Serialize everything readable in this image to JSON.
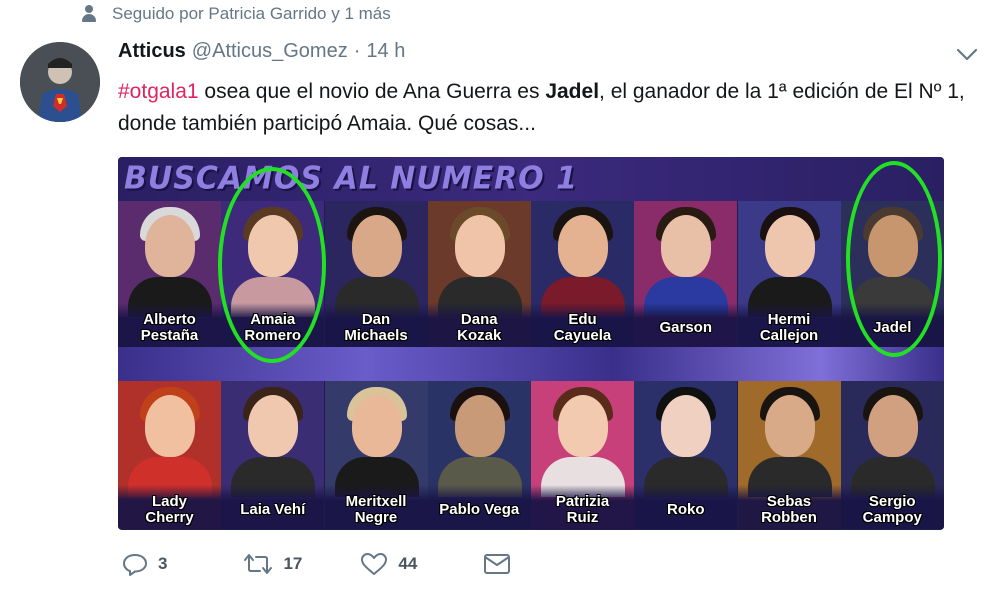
{
  "social_context": {
    "text": "Seguido por Patricia Garrido y 1 más"
  },
  "tweet": {
    "name": "Atticus",
    "handle": "@Atticus_Gomez",
    "separator": "·",
    "time": "14 h",
    "text": {
      "hashtag": "#otgala1",
      "part1": " osea que el novio de Ana Guerra es ",
      "bold": "Jadel",
      "part2": ", el ganador de la 1ª edición de El Nº 1, donde también participó Amaia. Qué cosas..."
    }
  },
  "media": {
    "banner_title": "BUSCAMOS AL NUMERO 1",
    "highlight_color": "#22e024",
    "row1": [
      "Alberto\nPestaña",
      "Amaia\nRomero",
      "Dan\nMichaels",
      "Dana\nKozak",
      "Edu\nCayuela",
      "Garson",
      "Hermi\nCallejon",
      "Jadel"
    ],
    "row2": [
      "Lady\nCherry",
      "Laia Vehí",
      "Meritxell\nNegre",
      "Pablo Vega",
      "Patrizia\nRuiz",
      "Roko",
      "Sebas\nRobben",
      "Sergio\nCampoy"
    ]
  },
  "actions": {
    "reply": {
      "icon": "reply-icon",
      "count": "3"
    },
    "retweet": {
      "icon": "retweet-icon",
      "count": "17"
    },
    "like": {
      "icon": "heart-icon",
      "count": "44"
    },
    "dm": {
      "icon": "envelope-icon"
    }
  },
  "colors": {
    "hashtag": "#e0245e",
    "secondary_text": "#657786",
    "media_bg": "#1e1b4d"
  }
}
